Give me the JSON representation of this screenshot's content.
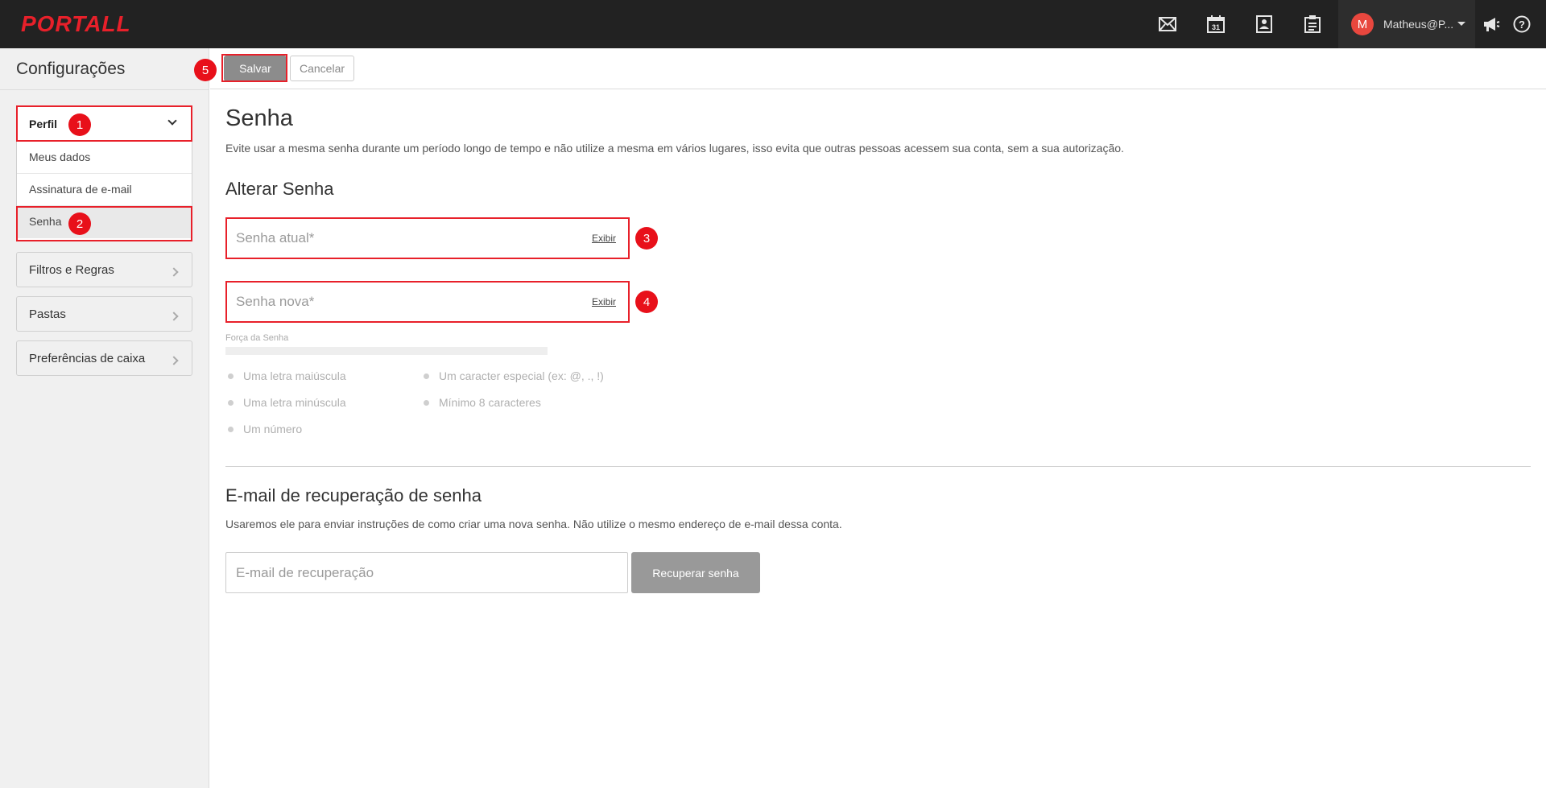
{
  "app": {
    "logo_text": "PORTALL"
  },
  "topbar": {
    "icons": [
      "mail-icon",
      "calendar-icon",
      "contacts-icon",
      "tasks-icon",
      "megaphone-icon",
      "help-icon"
    ],
    "calendar_day": "31",
    "user_initial": "M",
    "user_name": "Matheus@P..."
  },
  "sidebar": {
    "title": "Configurações",
    "perfil": {
      "label": "Perfil",
      "items": [
        "Meus dados",
        "Assinatura de e-mail",
        "Senha"
      ],
      "active_item": "Senha"
    },
    "groups": [
      "Filtros e Regras",
      "Pastas",
      "Preferências de caixa"
    ]
  },
  "toolbar": {
    "save_label": "Salvar",
    "cancel_label": "Cancelar"
  },
  "main": {
    "title": "Senha",
    "description": "Evite usar a mesma senha durante um período longo de tempo e não utilize a mesma em vários lugares, isso evita que outras pessoas acessem sua conta, sem a sua autorização.",
    "change_title": "Alterar Senha",
    "current_password_placeholder": "Senha atual*",
    "new_password_placeholder": "Senha nova*",
    "show_label": "Exibir",
    "strength_label": "Força da Senha",
    "strength_value": 0,
    "rules_left": [
      "Uma letra maiúscula",
      "Uma letra minúscula",
      "Um número"
    ],
    "rules_right": [
      "Um caracter especial (ex: @, ., !)",
      "Mínimo 8 caracteres"
    ],
    "recovery_title": "E-mail de recuperação de senha",
    "recovery_description": "Usaremos ele para enviar instruções de como criar uma nova senha. Não utilize o mesmo endereço de e-mail dessa conta.",
    "recovery_placeholder": "E-mail de recuperação",
    "recover_button": "Recuperar senha"
  },
  "annotations": [
    "1",
    "2",
    "3",
    "4",
    "5"
  ],
  "colors": {
    "topbar": "#222222",
    "accent_red": "#e8202a",
    "save_button": "#8c8c8c",
    "avatar": "#e8473e"
  }
}
